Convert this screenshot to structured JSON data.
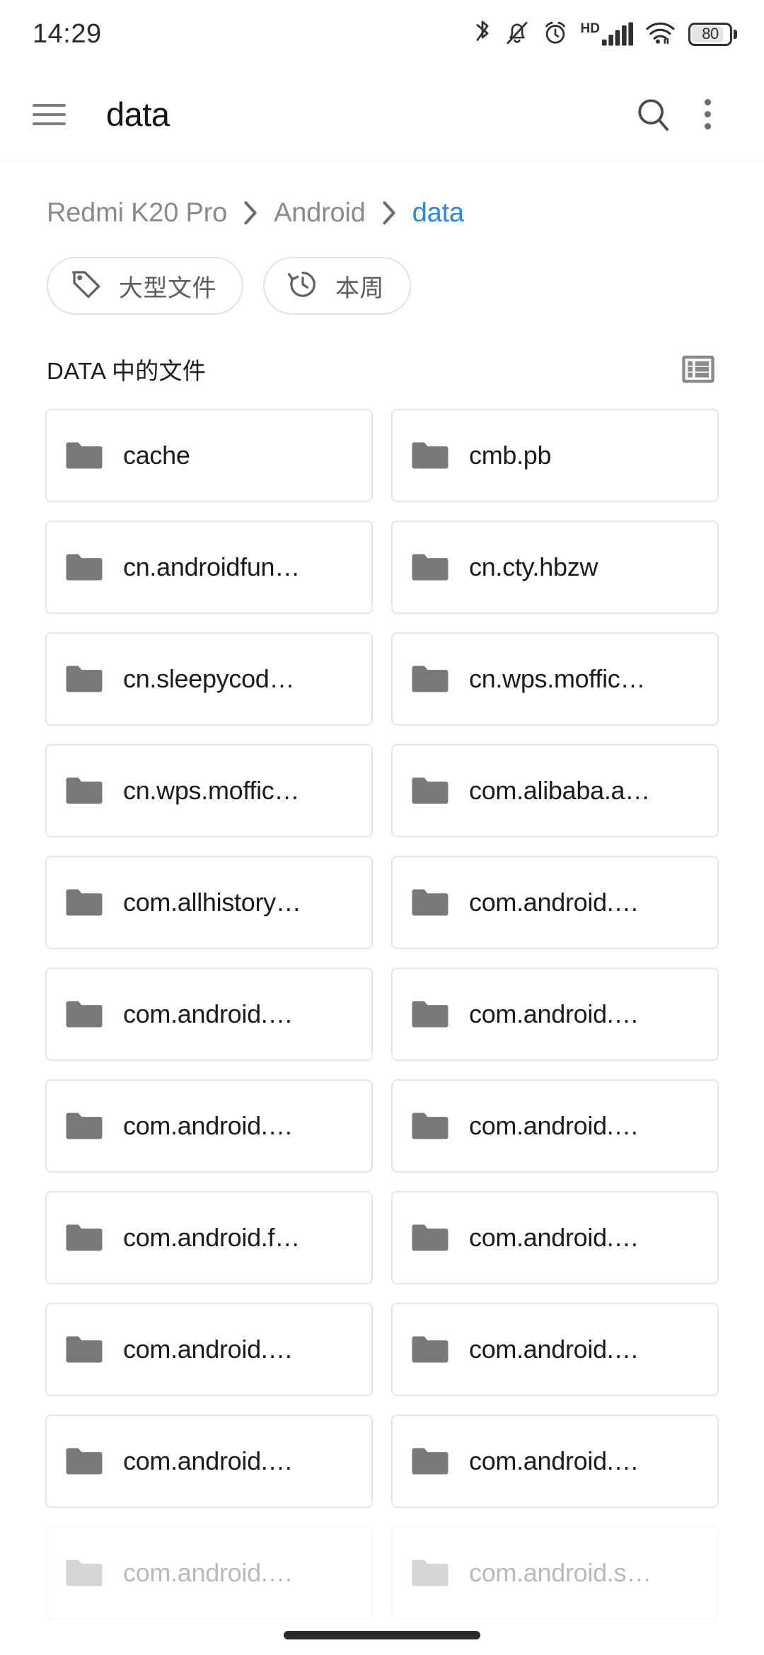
{
  "status_bar": {
    "time": "14:29",
    "battery_level": "80",
    "hd_label": "HD",
    "icons": [
      "bluetooth-icon",
      "bell-muted-icon",
      "alarm-clock-icon",
      "hd-signal-icon",
      "wifi-icon",
      "battery-icon"
    ]
  },
  "app_bar": {
    "title": "data",
    "menu_icon": "hamburger-menu-icon",
    "search_icon": "search-icon",
    "overflow_icon": "overflow-menu-icon"
  },
  "breadcrumb": {
    "separator": "›",
    "items": [
      {
        "label": "Redmi K20 Pro",
        "active": false
      },
      {
        "label": "Android",
        "active": false
      },
      {
        "label": "data",
        "active": true
      }
    ]
  },
  "chips": [
    {
      "label": "大型文件",
      "icon": "tag-icon"
    },
    {
      "label": "本周",
      "icon": "history-clock-icon"
    }
  ],
  "section": {
    "title": "DATA 中的文件",
    "view_toggle_icon": "list-view-icon"
  },
  "files": [
    {
      "name": "cache",
      "icon": "folder-icon",
      "faded": false
    },
    {
      "name": "cmb.pb",
      "icon": "folder-icon",
      "faded": false
    },
    {
      "name": "cn.androidfun…",
      "icon": "folder-icon",
      "faded": false
    },
    {
      "name": "cn.cty.hbzw",
      "icon": "folder-icon",
      "faded": false
    },
    {
      "name": "cn.sleepycod…",
      "icon": "folder-icon",
      "faded": false
    },
    {
      "name": "cn.wps.moffic…",
      "icon": "folder-icon",
      "faded": false
    },
    {
      "name": "cn.wps.moffic…",
      "icon": "folder-icon",
      "faded": false
    },
    {
      "name": "com.alibaba.a…",
      "icon": "folder-icon",
      "faded": false
    },
    {
      "name": "com.allhistory…",
      "icon": "folder-icon",
      "faded": false
    },
    {
      "name": "com.android.…",
      "icon": "folder-icon",
      "faded": false
    },
    {
      "name": "com.android.…",
      "icon": "folder-icon",
      "faded": false
    },
    {
      "name": "com.android.…",
      "icon": "folder-icon",
      "faded": false
    },
    {
      "name": "com.android.…",
      "icon": "folder-icon",
      "faded": false
    },
    {
      "name": "com.android.…",
      "icon": "folder-icon",
      "faded": false
    },
    {
      "name": "com.android.f…",
      "icon": "folder-icon",
      "faded": false
    },
    {
      "name": "com.android.…",
      "icon": "folder-icon",
      "faded": false
    },
    {
      "name": "com.android.…",
      "icon": "folder-icon",
      "faded": false
    },
    {
      "name": "com.android.…",
      "icon": "folder-icon",
      "faded": false
    },
    {
      "name": "com.android.…",
      "icon": "folder-icon",
      "faded": false
    },
    {
      "name": "com.android.…",
      "icon": "folder-icon",
      "faded": false
    },
    {
      "name": "com.android.…",
      "icon": "folder-icon",
      "faded": true
    },
    {
      "name": "com.android.s…",
      "icon": "folder-icon",
      "faded": true
    }
  ],
  "colors": {
    "accent": "#2a88e0",
    "folder": "#787878",
    "card_border": "#e6e6e6",
    "text_primary": "#1b1b1b",
    "text_secondary": "#8a8a8a"
  },
  "gesture_bar": {
    "label": "home-gesture-bar"
  }
}
